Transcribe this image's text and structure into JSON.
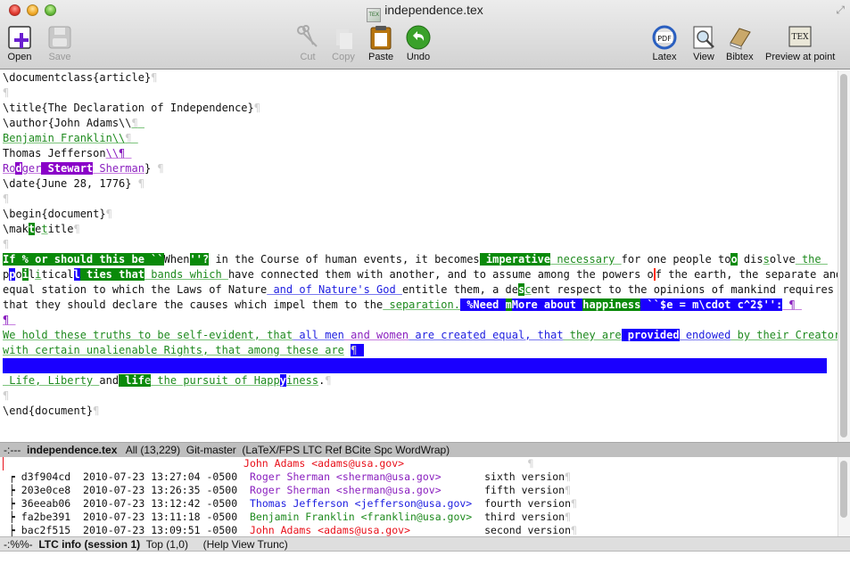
{
  "window": {
    "title": "independence.tex",
    "doc_icon": "tex-file-icon"
  },
  "toolbar": {
    "open": "Open",
    "save": "Save",
    "cut": "Cut",
    "copy": "Copy",
    "paste": "Paste",
    "undo": "Undo",
    "latex": "Latex",
    "view": "View",
    "bibtex": "Bibtex",
    "preview": "Preview at point",
    "latex_icon_text": "PDF",
    "preview_icon_text": "TEX"
  },
  "editor": {
    "pilcrow": "¶",
    "lines": {
      "l1": "\\documentclass{article}",
      "l3": "\\title{The Declaration of Independence}",
      "l4": "\\author{John Adams\\\\",
      "l5": "Benjamin Franklin\\\\",
      "l6a": "Thomas Jefferson",
      "l6b": "\\\\",
      "l7a": "Ro",
      "l7b": "d",
      "l7c": "ger",
      "l7d": " Stewart",
      "l7e": " Sherman",
      "l7f": "} ",
      "l8": "\\date{June 28, 1776} ",
      "l10": "\\begin{document}",
      "l11a": "\\mak",
      "l11b": "t",
      "l11c": "e",
      "l11d": "t",
      "l11e": "itle",
      "p1a": "If % or should this be ``",
      "p1b": "When",
      "p1c": "''?",
      "p1d": " in the Course of human events, it becomes",
      "p1e": " imperative",
      "p1f": " necessary ",
      "p1g": "for one people to",
      "p1h": "o",
      "p1i": " dis",
      "p1j": "s",
      "p1k": "olve",
      "p1l": " the ",
      "p2a": "p",
      "p2b": "p",
      "p2c": "o",
      "p2d": "i",
      "p2e": "l",
      "p2f": "i",
      "p2g": "tical",
      "p2h": "l",
      "p2i": " ties that",
      "p2j": " bands which ",
      "p2k": "have connected them with another, and to assume among the powers o",
      "p2l": "f the earth, the separate and",
      "p3a": "equal station to which the Laws of Nature",
      "p3b": " and of Nature's God ",
      "p3c": "entitle them, a de",
      "p3d": "s",
      "p3e": "c",
      "p3f": "ent respect to the opinions of mankind requires",
      "p4a": "that they should declare the causes which impel them to the",
      "p4b": " separation.",
      "p4c": " %Need ",
      "p4d": "m",
      "p4e": "More about ",
      "p4f": "happiness",
      "p4g": " ``$e = m\\cdot c^2$'':",
      "w1a": "We hold these truths to be self-evident, that",
      "w1b": " all men",
      "w1c": " and women",
      "w1d": " are created equal, that",
      "w1e": " they are",
      "w1f": " provided",
      "w1g": " endowed",
      "w1h": " by their Creator ",
      "w2a": "with certain unalienable Rights, that among these are",
      "w4a": " Life, Liberty ",
      "w4b": "and",
      "w4c": " lif",
      "w4d": "e",
      "w4e": " the pursuit of Happ",
      "w4f": "y",
      "w4g": "iness",
      "end": "\\end{document}"
    }
  },
  "modeline_main": {
    "prefix": "-:---  ",
    "buffer": "independence.tex",
    "rest": "   All (13,229)  Git-master  (LaTeX/FPS LTC Ref BCite Spc WordWrap)"
  },
  "log": {
    "header_author": "John Adams <adams@usa.gov>",
    "rows": [
      {
        "hash": "d3f904cd",
        "date": "2010-07-23 13:27:04 -0500",
        "author": "Roger Sherman <sherman@usa.gov>",
        "message": "sixth version"
      },
      {
        "hash": "203e0ce8",
        "date": "2010-07-23 13:26:35 -0500",
        "author": "Roger Sherman <sherman@usa.gov>",
        "message": "fifth version"
      },
      {
        "hash": "36eeab06",
        "date": "2010-07-23 13:12:42 -0500",
        "author": "Thomas Jefferson <jefferson@usa.gov>",
        "message": "fourth version"
      },
      {
        "hash": "fa2be391",
        "date": "2010-07-23 13:11:18 -0500",
        "author": "Benjamin Franklin <franklin@usa.gov>",
        "message": "third version"
      },
      {
        "hash": "bac2f515",
        "date": "2010-07-23 13:09:51 -0500",
        "author": "John Adams <adams@usa.gov>",
        "message": "second version"
      }
    ]
  },
  "modeline_info": {
    "prefix": "-:%%-  ",
    "buffer": "LTC info (session 1)",
    "rest": "  Top (1,0)     (Help View Trunc)"
  },
  "colors": {
    "john_adams": "#e8101a",
    "roger_sherman": "#8a1fbf",
    "thomas_jefferson": "#1d1de0",
    "benjamin_franklin": "#1e8a1e",
    "highlight_green": "#0a8a0a",
    "highlight_blue": "#1a00ff"
  }
}
